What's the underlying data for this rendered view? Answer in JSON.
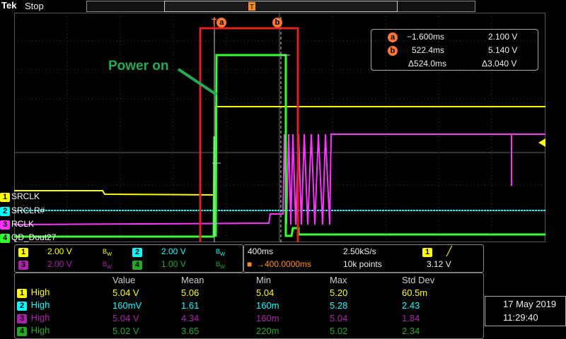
{
  "header": {
    "brand": "Tek",
    "run_state": "Stop"
  },
  "annotations": {
    "power_on": "Power on"
  },
  "cursor_readout": {
    "a_label": "a",
    "b_label": "b",
    "a_time": "−1.600ms",
    "a_volt": "2.100 V",
    "b_time": "522.4ms",
    "b_volt": "5.140 V",
    "delta_time": "Δ524.0ms",
    "delta_volt": "Δ3.040 V"
  },
  "channels": [
    {
      "num": "1",
      "name": "SRCLK",
      "color": "#ffff00"
    },
    {
      "num": "2",
      "name": "SRCLR#",
      "color": "#00ffff"
    },
    {
      "num": "3",
      "name": "RCLK",
      "color": "#ff33ff"
    },
    {
      "num": "4",
      "name": "QD_Dout27",
      "color": "#33ff33"
    }
  ],
  "vert_settings": {
    "ch1": "2.00 V",
    "ch2": "2.00 V",
    "ch3": "2.00 V",
    "ch4": "1.00 V",
    "bw": "B",
    "bw_sub": "W"
  },
  "horiz_settings": {
    "timebase": "400ms",
    "sample_rate": "2.50kS/s",
    "position": "→400.0000ms",
    "record": "10k points",
    "trigger_ch": "1",
    "trigger_level": "3.12 V"
  },
  "measurements": {
    "headers": [
      "Value",
      "Mean",
      "Min",
      "Max",
      "Std Dev"
    ],
    "rows": [
      {
        "ch": "1",
        "type": "High",
        "value": "5.04 V",
        "mean": "5.06",
        "min": "5.04",
        "max": "5.20",
        "std": "60.5m"
      },
      {
        "ch": "2",
        "type": "High",
        "value": "160mV",
        "mean": "1.61",
        "min": "160m",
        "max": "5.28",
        "std": "2.43"
      },
      {
        "ch": "3",
        "type": "High",
        "value": "5.04 V",
        "mean": "4.34",
        "min": "160m",
        "max": "5.04",
        "std": "1.84"
      },
      {
        "ch": "4",
        "type": "High",
        "value": "5.02 V",
        "mean": "3.65",
        "min": "220m",
        "max": "5.02",
        "std": "2.34"
      }
    ]
  },
  "datetime": {
    "date": "17 May 2019",
    "time": "11:29:40"
  },
  "colors": {
    "ch1": "#ffff00",
    "ch2": "#00ffff",
    "ch3": "#ff33ff",
    "ch4": "#33ff33",
    "highlight_box": "#e02020",
    "annotation": "#22aa55",
    "cursor_badge": "#ff7733"
  }
}
